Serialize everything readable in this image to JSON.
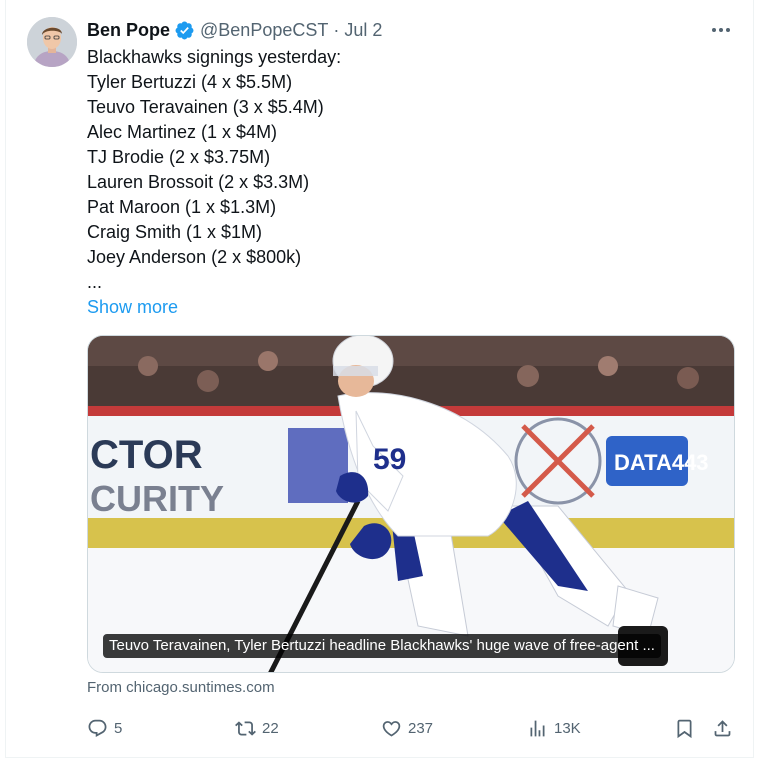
{
  "author": {
    "name": "Ben Pope",
    "handle": "@BenPopeCST",
    "separator": "·",
    "date": "Jul 2"
  },
  "tweet": {
    "lines": [
      "Blackhawks signings yesterday:",
      "Tyler Bertuzzi (4 x $5.5M)",
      "Teuvo Teravainen (3 x $5.4M)",
      "Alec Martinez (1 x $4M)",
      "TJ Brodie (2 x $3.75M)",
      "Lauren Brossoit (2 x $3.3M)",
      "Pat Maroon (1 x $1.3M)",
      "Craig Smith (1 x $1M)",
      "Joey Anderson (2 x $800k)",
      "..."
    ],
    "show_more": "Show more"
  },
  "card": {
    "title": "Teuvo Teravainen, Tyler Bertuzzi headline Blackhawks' huge wave of free-agent ...",
    "source": "From chicago.suntimes.com",
    "photo_text": {
      "board_left_1": "CTOR",
      "board_left_2": "CURITY",
      "jersey_number": "59",
      "board_right": "DATA443"
    }
  },
  "actions": {
    "replies": "5",
    "reposts": "22",
    "likes": "237",
    "views": "13K"
  },
  "colors": {
    "accent": "#1d9bf0",
    "secondary_text": "#536471",
    "leafs_blue": "#1e2f8c"
  }
}
